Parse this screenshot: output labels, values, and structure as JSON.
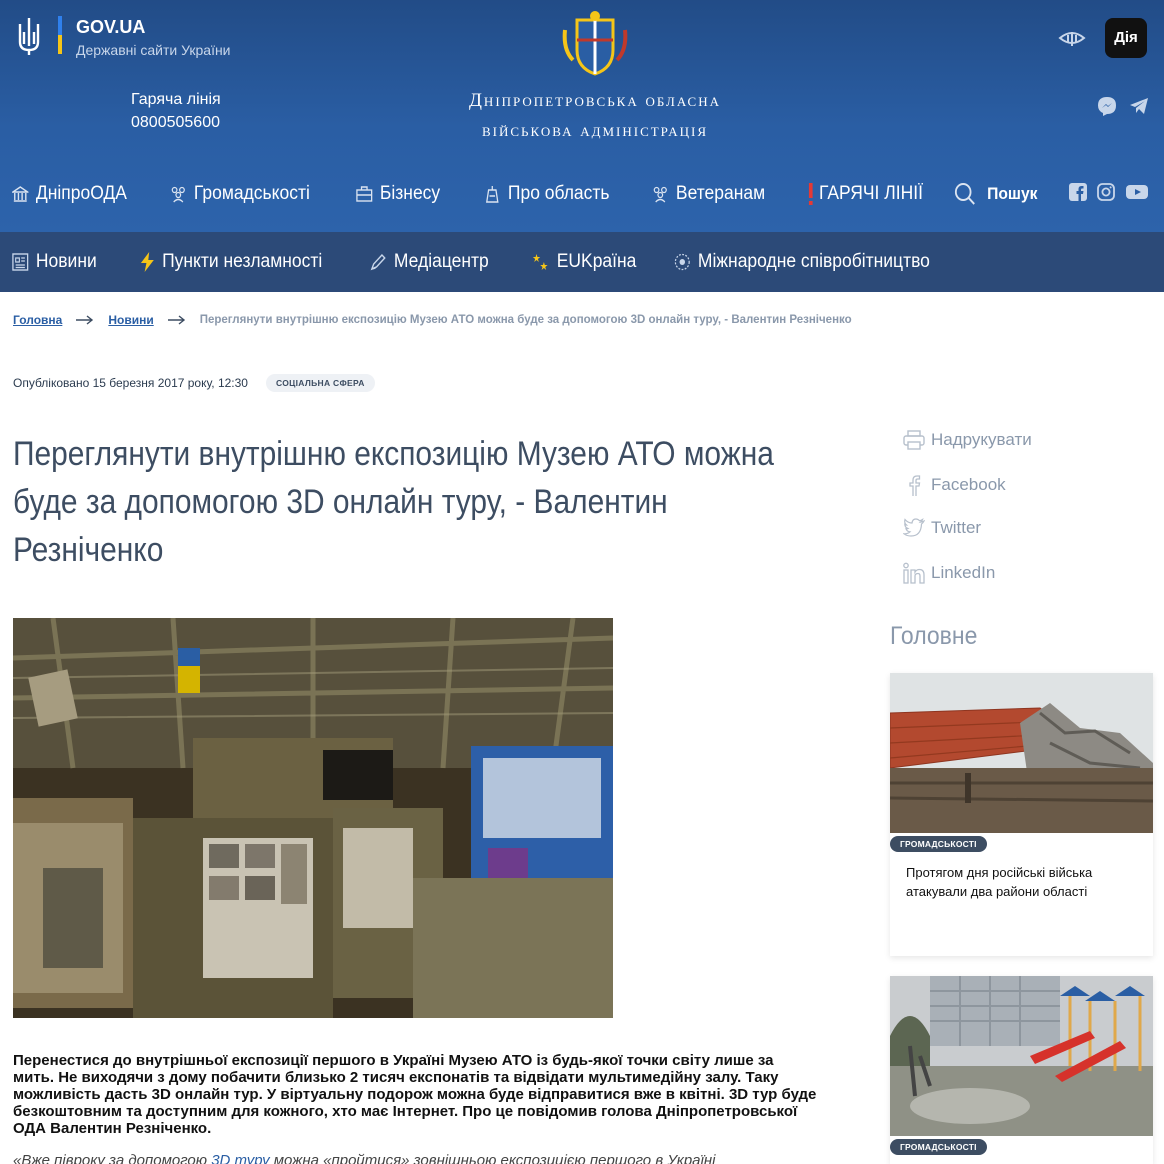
{
  "header": {
    "gov_title": "GOV.UA",
    "gov_subtitle": "Державні сайти України",
    "hotline_label": "Гаряча лінія",
    "hotline_number": "0800505600",
    "site_title_line1": "Дніпропетровська обласна",
    "site_title_line2": "військова адміністрація",
    "diia_label": "Дія"
  },
  "main_nav": {
    "items": [
      {
        "label": "ДніпроОДА",
        "icon": "building-icon"
      },
      {
        "label": "Громадськості",
        "icon": "people-icon"
      },
      {
        "label": "Бізнесу",
        "icon": "briefcase-icon"
      },
      {
        "label": "Про область",
        "icon": "landmark-icon"
      },
      {
        "label": "Ветеранам",
        "icon": "people-icon"
      },
      {
        "label": "ГАРЯЧІ ЛІНІЇ",
        "icon": "exclamation-icon"
      }
    ],
    "search_label": "Пошук"
  },
  "sub_nav": {
    "items": [
      {
        "label": "Новини",
        "icon": "news-icon"
      },
      {
        "label": "Пункти незламності",
        "icon": "lightning-icon"
      },
      {
        "label": "Медіацентр",
        "icon": "pen-icon"
      },
      {
        "label": "EUKраїна",
        "icon": "eu-stars-icon"
      },
      {
        "label": "Міжнародне співробітництво",
        "icon": "globe-icon"
      }
    ]
  },
  "breadcrumb": {
    "home": "Головна",
    "news": "Новини",
    "current": "Переглянути внутрішню експозицію Музею АТО можна буде за допомогою 3D онлайн туру, - Валентин Резніченко"
  },
  "article": {
    "published": "Опубліковано 15 березня 2017 року, 12:30",
    "tag": "СОЦІАЛЬНА СФЕРА",
    "title": "Переглянути внутрішню експозицію Музею АТО можна буде за допомогою 3D онлайн туру, - Валентин Резніченко",
    "lead": "Перенестися до внутрішньої експозиції першого в Україні Музею АТО із будь-якої точки світу лише за мить. Не виходячи з дому побачити близько 2 тисяч експонатів та відвідати мультимедійну залу. Таку можливість дасть 3D онлайн тур. У віртуальну подорож можна буде відправитися вже в квітні. 3D тур буде безкоштовним та доступним для кожного, хто має Інтернет. Про це повідомив голова Дніпропетровської ОДА Валентин Резніченко.",
    "quote_start": "«Вже півроку за допомогою ",
    "quote_link": "3D туру",
    "quote_end": " можна «пройтися» зовнішньою експозицією першого в Україні"
  },
  "share": {
    "print": "Надрукувати",
    "facebook": "Facebook",
    "twitter": "Twitter",
    "linkedin": "LinkedIn"
  },
  "sidebar": {
    "title": "Головне",
    "cards": [
      {
        "tag": "ГРОМАДСЬКОСТІ",
        "text": "Протягом дня російські війська атакували два райони області"
      },
      {
        "tag": "ГРОМАДСЬКОСТІ",
        "text": ""
      }
    ]
  }
}
